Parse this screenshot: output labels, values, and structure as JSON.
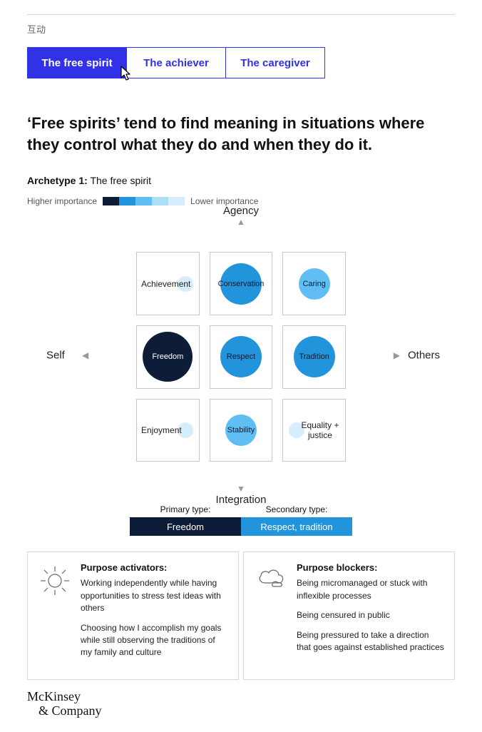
{
  "kicker": "互动",
  "tabs": [
    {
      "label": "The free spirit",
      "active": true
    },
    {
      "label": "The achiever",
      "active": false
    },
    {
      "label": "The caregiver",
      "active": false
    }
  ],
  "headline": "‘Free spirits’ tend to find meaning in situations where they control what they do and when they do it.",
  "archetype": {
    "prefix": "Archetype 1:",
    "name": "The free spirit"
  },
  "legend": {
    "left": "Higher importance",
    "right": "Lower importance"
  },
  "axes": {
    "top": "Agency",
    "bottom": "Integration",
    "left": "Self",
    "right": "Others"
  },
  "type_labels": {
    "primary": "Primary type:",
    "secondary": "Secondary type:"
  },
  "type_values": {
    "primary": "Freedom",
    "secondary": "Respect, tradition"
  },
  "activators": {
    "title": "Purpose activators:",
    "items": [
      "Working independently while having opportunities to stress test ideas with others",
      "Choosing how I accomplish my goals while still observing the traditions of my family and culture"
    ]
  },
  "blockers": {
    "title": "Purpose blockers:",
    "items": [
      "Being micromanaged or stuck with inflexible processes",
      "Being censured in public",
      "Being pressured to take a direction that goes against established practices"
    ]
  },
  "brand": {
    "line1": "McKinsey",
    "line2": "& Company"
  },
  "importance_colors": [
    "#0e1d37",
    "#2294db",
    "#60bef2",
    "#abdff8",
    "#d6eefb"
  ],
  "chart_data": {
    "type": "heatmap",
    "title": "Importance of meaning sources — The free spirit",
    "x_axis": {
      "left": "Self",
      "right": "Others"
    },
    "y_axis": {
      "top": "Agency",
      "bottom": "Integration"
    },
    "importance_scale": {
      "1": "highest",
      "5": "lowest",
      "colors": [
        "#0e1d37",
        "#2294db",
        "#60bef2",
        "#abdff8",
        "#d6eefb"
      ]
    },
    "cells": [
      {
        "row": 0,
        "col": 0,
        "label": "Achievement",
        "importance": 5,
        "label_in_circle": false,
        "label_side": "left"
      },
      {
        "row": 0,
        "col": 1,
        "label": "Conservation",
        "importance": 2,
        "label_in_circle": true
      },
      {
        "row": 0,
        "col": 2,
        "label": "Caring",
        "importance": 3,
        "label_in_circle": true
      },
      {
        "row": 1,
        "col": 0,
        "label": "Freedom",
        "importance": 1,
        "label_in_circle": true
      },
      {
        "row": 1,
        "col": 1,
        "label": "Respect",
        "importance": 2,
        "label_in_circle": true
      },
      {
        "row": 1,
        "col": 2,
        "label": "Tradition",
        "importance": 2,
        "label_in_circle": true
      },
      {
        "row": 2,
        "col": 0,
        "label": "Enjoyment",
        "importance": 5,
        "label_in_circle": false,
        "label_side": "left"
      },
      {
        "row": 2,
        "col": 1,
        "label": "Stability",
        "importance": 3,
        "label_in_circle": true
      },
      {
        "row": 2,
        "col": 2,
        "label": "Equality + justice",
        "importance": 5,
        "label_in_circle": false,
        "label_side": "right"
      }
    ],
    "primary_type": "Freedom",
    "secondary_type": "Respect, tradition"
  }
}
